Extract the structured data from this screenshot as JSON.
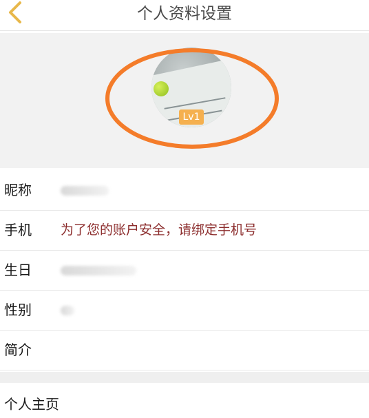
{
  "header": {
    "title": "个人资料设置",
    "back_icon": "chevron-left-icon",
    "back_color": "#e8b84a"
  },
  "avatar": {
    "level_badge": "Lv1",
    "annotation_color": "#f47c2a"
  },
  "rows": [
    {
      "label": "昵称",
      "value": ""
    },
    {
      "label": "手机",
      "value": "为了您的账户安全，请绑定手机号"
    },
    {
      "label": "生日",
      "value": ""
    },
    {
      "label": "性别",
      "value": ""
    },
    {
      "label": "简介",
      "value": ""
    }
  ],
  "homepage": {
    "label": "个人主页"
  }
}
